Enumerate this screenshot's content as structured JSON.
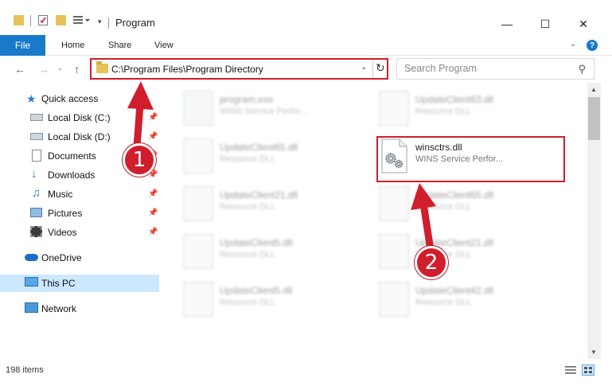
{
  "window": {
    "title": "Program",
    "controls": {
      "minimize": "—",
      "maximize": "☐",
      "close": "✕"
    }
  },
  "ribbon": {
    "file_tab": "File",
    "tabs": [
      "Home",
      "Share",
      "View"
    ],
    "help": "?"
  },
  "address_bar": {
    "path": "C:\\Program Files\\Program Directory"
  },
  "search": {
    "placeholder": "Search Program"
  },
  "sidebar": {
    "quick_access": "Quick access",
    "items": [
      {
        "label": "Local Disk (C:)",
        "icon": "drive-icon"
      },
      {
        "label": "Local Disk (D:)",
        "icon": "drive-icon"
      },
      {
        "label": "Documents",
        "icon": "documents-icon"
      },
      {
        "label": "Downloads",
        "icon": "downloads-icon"
      },
      {
        "label": "Music",
        "icon": "music-icon"
      },
      {
        "label": "Pictures",
        "icon": "pictures-icon"
      },
      {
        "label": "Videos",
        "icon": "videos-icon"
      }
    ],
    "onedrive": "OneDrive",
    "this_pc": "This PC",
    "network": "Network"
  },
  "files": [
    {
      "name": "program.exe",
      "desc": "WINS Service Perfor..."
    },
    {
      "name": "UpdateClient63.dll",
      "desc": "Resource DLL"
    },
    {
      "name": "UpdateClient65.dll",
      "desc": "Resource DLL"
    },
    {
      "name": "winsctrs.dll",
      "desc": "WINS Service Perfor..."
    },
    {
      "name": "UpdateClient21.dll",
      "desc": "Resource DLL"
    },
    {
      "name": "UpdateClient65.dll",
      "desc": "Resource DLL"
    },
    {
      "name": "UpdateClient5.dll",
      "desc": "Resource DLL"
    },
    {
      "name": "UpdateClient21.dll",
      "desc": "Resource DLL"
    },
    {
      "name": "UpdateClient5.dll",
      "desc": "Resource DLL"
    },
    {
      "name": "UpdateClient42.dll",
      "desc": "Resource DLL"
    }
  ],
  "status": {
    "item_count": "198 items"
  },
  "annotations": {
    "step1": "1",
    "step2": "2"
  },
  "colors": {
    "accent": "#1979ca",
    "highlight_red": "#d11e2c",
    "selected_bg": "#cce8ff"
  }
}
